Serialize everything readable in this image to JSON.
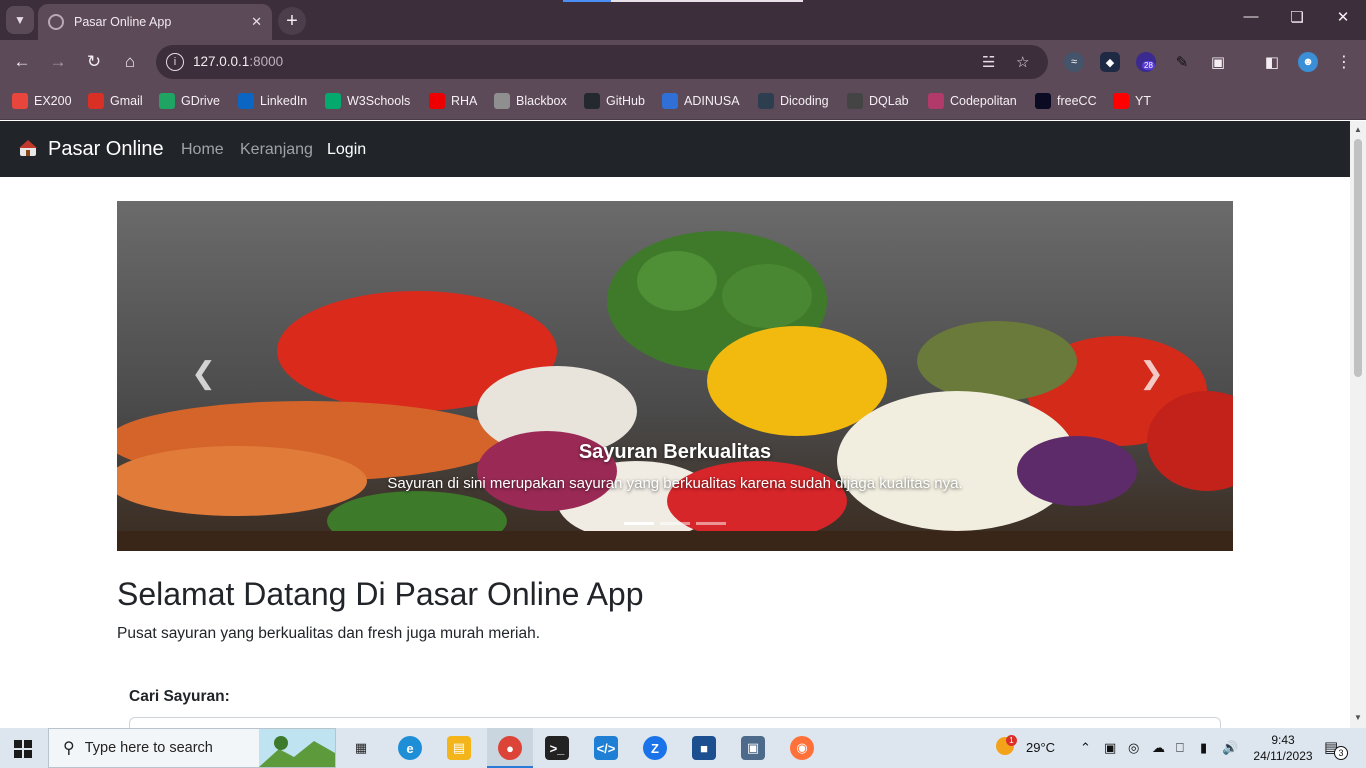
{
  "browser": {
    "tab_title": "Pasar Online App",
    "url_host": "127.0.0.1",
    "url_port": ":8000",
    "extension_badge": "28",
    "bookmarks": [
      {
        "label": "EX200",
        "color": "#e8453c"
      },
      {
        "label": "Gmail",
        "color": "#d93025"
      },
      {
        "label": "GDrive",
        "color": "#1fa463"
      },
      {
        "label": "LinkedIn",
        "color": "#0a66c2"
      },
      {
        "label": "W3Schools",
        "color": "#04aa6d"
      },
      {
        "label": "RHA",
        "color": "#ee0000"
      },
      {
        "label": "Blackbox",
        "color": "#8f8f8f"
      },
      {
        "label": "GitHub",
        "color": "#24292f"
      },
      {
        "label": "ADINUSA",
        "color": "#2f6fd6"
      },
      {
        "label": "Dicoding",
        "color": "#2d3e50"
      },
      {
        "label": "DQLab",
        "color": "#444444"
      },
      {
        "label": "Codepolitan",
        "color": "#b13a6a"
      },
      {
        "label": "freeCC",
        "color": "#0a0a23"
      },
      {
        "label": "YT",
        "color": "#ff0000"
      }
    ]
  },
  "site": {
    "brand": "Pasar Online",
    "nav": [
      "Home",
      "Keranjang",
      "Login"
    ],
    "carousel": {
      "caption_title": "Sayuran Berkualitas",
      "caption_text": "Sayuran di sini merupakan sayuran yang berkualitas karena sudah dijaga kualitas nya.",
      "slides": 3,
      "active_slide": 1
    },
    "welcome_title": "Selamat Datang Di Pasar Online App",
    "lead": "Pusat sayuran yang berkualitas dan fresh juga murah meriah.",
    "search_label": "Cari Sayuran:"
  },
  "taskbar": {
    "search_placeholder": "Type here to search",
    "weather": "29°C",
    "weather_badge": "1",
    "time": "9:43",
    "date": "24/11/2023",
    "notifications": "3"
  }
}
